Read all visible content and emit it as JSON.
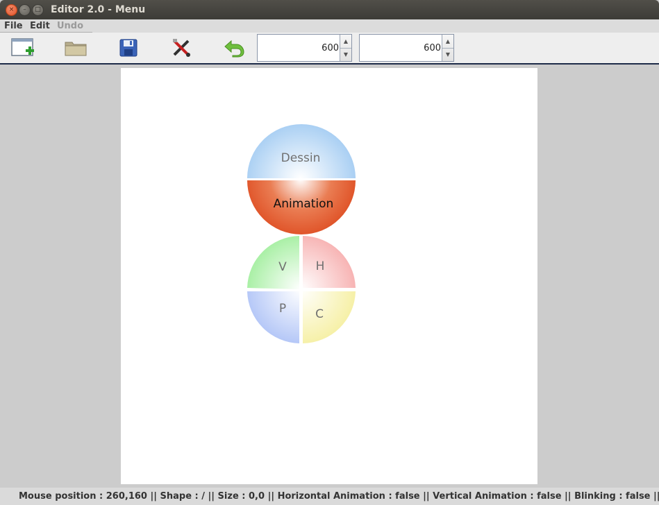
{
  "window": {
    "title": "Editor 2.0 - Menu",
    "close_glyph": "×",
    "minimize_glyph": "–",
    "maximize_glyph": "□"
  },
  "menubar": {
    "items": [
      {
        "label": "File",
        "enabled": true
      },
      {
        "label": "Edit",
        "enabled": true
      },
      {
        "label": "Undo",
        "enabled": false
      }
    ]
  },
  "toolbar": {
    "buttons": [
      {
        "icon": "new-file-icon"
      },
      {
        "icon": "open-folder-icon"
      },
      {
        "icon": "save-icon"
      },
      {
        "icon": "tools-icon"
      },
      {
        "icon": "undo-icon"
      }
    ],
    "width_spinner": {
      "value": "600"
    },
    "height_spinner": {
      "value": "600"
    },
    "spinner_up_glyph": "▲",
    "spinner_down_glyph": "▼"
  },
  "menu_wheel_top": {
    "segments": [
      {
        "label": "Dessin",
        "color": "#a9cff3"
      },
      {
        "label": "Animation",
        "color": "#e0552a"
      }
    ]
  },
  "menu_wheel_bottom": {
    "segments": [
      {
        "label": "V",
        "color": "#a6efa2"
      },
      {
        "label": "H",
        "color": "#f7b3b3"
      },
      {
        "label": "P",
        "color": "#b3c6f7"
      },
      {
        "label": "C",
        "color": "#f6f0a6"
      }
    ]
  },
  "statusbar": {
    "text": "Mouse position : 260,160 ||  Shape : / ||  Size : 0,0 ||  Horizontal Animation : false ||  Vertical Animation : false ||  Blinking : false ||"
  }
}
